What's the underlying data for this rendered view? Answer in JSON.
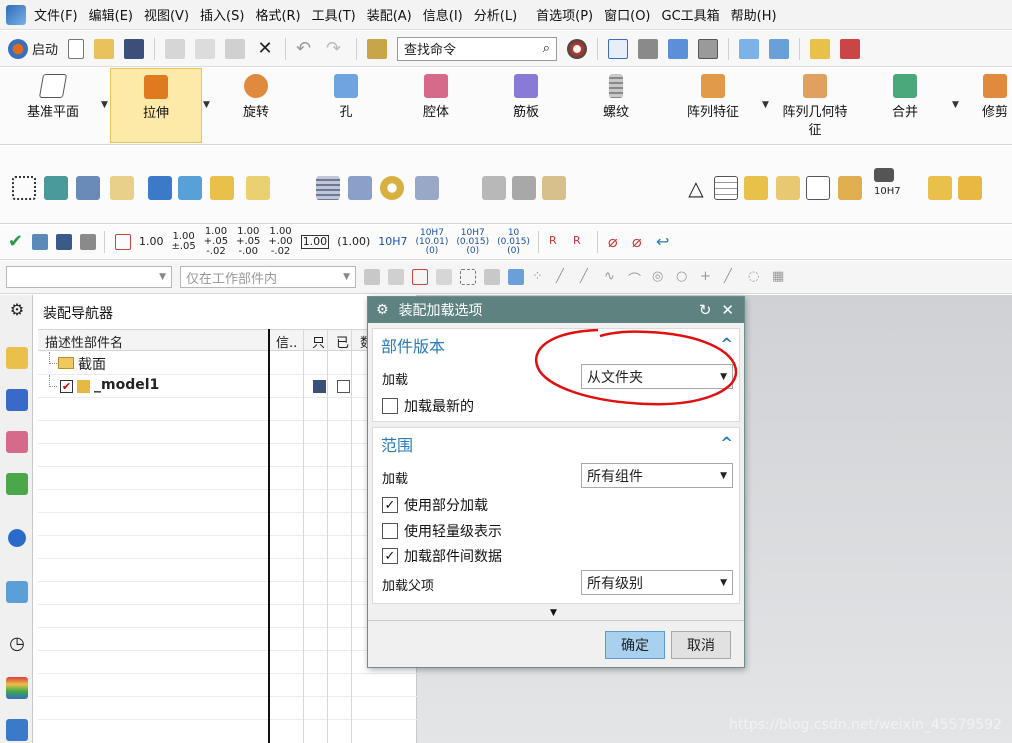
{
  "menu": [
    "文件(F)",
    "编辑(E)",
    "视图(V)",
    "插入(S)",
    "格式(R)",
    "工具(T)",
    "装配(A)",
    "信息(I)",
    "分析(L)",
    "首选项(P)",
    "窗口(O)",
    "GC工具箱",
    "帮助(H)"
  ],
  "toolbar": {
    "start_label": "启动",
    "search_placeholder": "查找命令"
  },
  "ribbon": {
    "items": [
      {
        "label": "基准平面"
      },
      {
        "label": "拉伸"
      },
      {
        "label": "旋转"
      },
      {
        "label": "孔"
      },
      {
        "label": "腔体"
      },
      {
        "label": "筋板"
      },
      {
        "label": "螺纹"
      },
      {
        "label": "阵列特征"
      },
      {
        "label": "阵列几何特\n征"
      },
      {
        "label": "合并"
      },
      {
        "label": "修剪"
      }
    ]
  },
  "row2": {
    "tol_label": "10H7"
  },
  "dim_row": {
    "items": [
      "1.00",
      "1.00\n±.05",
      "1.00\n+.05\n-.02",
      "1.00\n+.05\n-.00",
      "1.00\n+.00\n-.02",
      "1.00",
      "(1.00)",
      "10H7",
      "10H7\n(10.01)\n(0)",
      "10H7\n(0.015)\n(0)",
      "10\n(0.015)\n(0)"
    ]
  },
  "filter": {
    "combo1": "",
    "combo2": "仅在工作部件内"
  },
  "navigator": {
    "title": "装配导航器",
    "columns": [
      "描述性部件名",
      "信..",
      "只",
      "已",
      "数"
    ],
    "rows": [
      {
        "name": "截面"
      },
      {
        "name": "_model1"
      }
    ]
  },
  "dialog": {
    "title": "装配加载选项",
    "section1": {
      "title": "部件版本",
      "load_label": "加载",
      "load_value": "从文件夹",
      "load_latest": "加载最新的",
      "load_latest_checked": false
    },
    "section2": {
      "title": "范围",
      "load_label": "加载",
      "load_value": "所有组件",
      "opt1": "使用部分加载",
      "opt1_checked": true,
      "opt2": "使用轻量级表示",
      "opt2_checked": false,
      "opt3": "加载部件间数据",
      "opt3_checked": true,
      "parent_label": "加载父项",
      "parent_value": "所有级别"
    },
    "ok": "确定",
    "cancel": "取消"
  },
  "watermark": "https://blog.csdn.net/weixin_45579592",
  "colors": {
    "dialog_title_bg": "#5e8280",
    "section_title": "#2a7bb8",
    "ok_bg": "#a8d1f0",
    "active_ribbon": "#fde9a8",
    "annotation_red": "#e01010"
  }
}
